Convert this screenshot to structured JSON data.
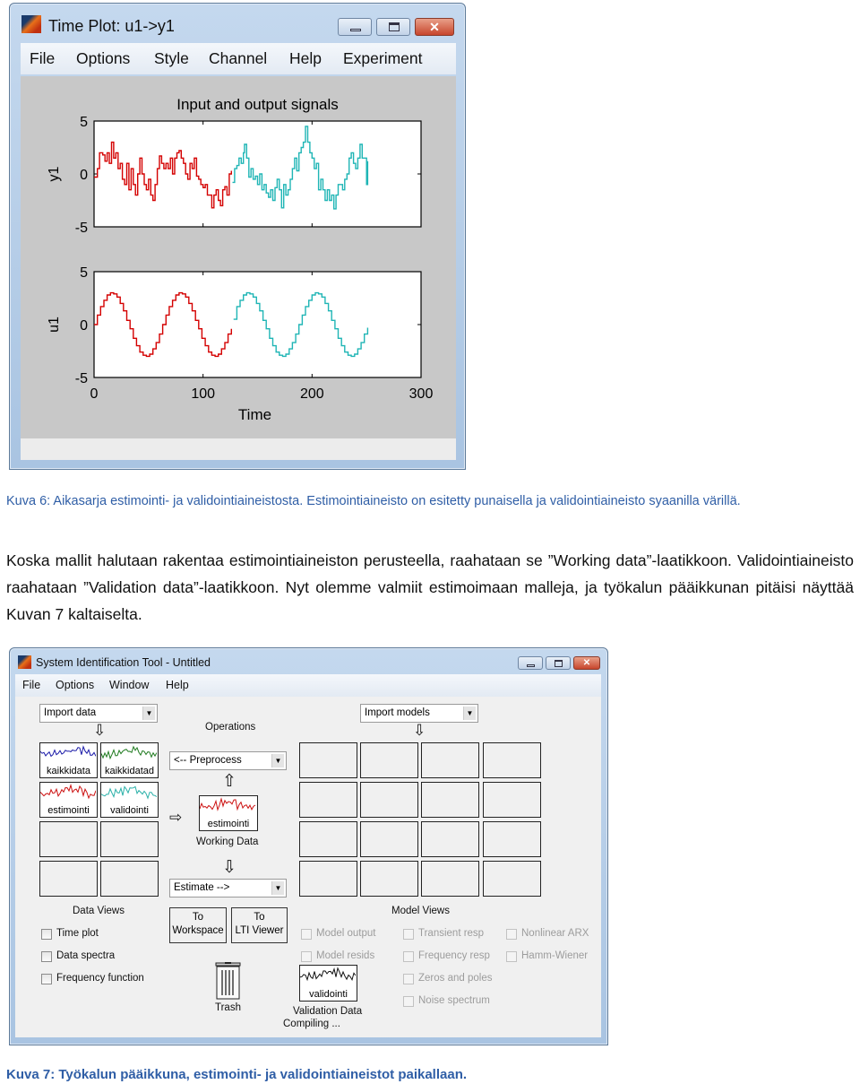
{
  "figure1": {
    "window_title": "Time Plot: u1->y1",
    "menu": [
      "File",
      "Options",
      "Style",
      "Channel",
      "Help",
      "Experiment"
    ],
    "window_buttons": {
      "minimize": "minimize-icon",
      "maximize": "maximize-icon",
      "close": "close-icon"
    }
  },
  "chart_data": [
    {
      "type": "line",
      "title": "Input and output signals",
      "xlabel": "",
      "ylabel": "y1",
      "xlim": [
        0,
        300
      ],
      "ylim": [
        -5,
        5
      ],
      "xticks": [
        "0",
        "100",
        "200",
        "300"
      ],
      "show_xtick_labels": false,
      "yticks": [
        "-5",
        "0",
        "5"
      ],
      "series": [
        {
          "color": "#d40000",
          "points": [
            [
              0,
              -0.3
            ],
            [
              3,
              0.5
            ],
            [
              5,
              2
            ],
            [
              8,
              1.8
            ],
            [
              10,
              1.2
            ],
            [
              12,
              2
            ],
            [
              14,
              1
            ],
            [
              16,
              3
            ],
            [
              18,
              1.5
            ],
            [
              20,
              2
            ],
            [
              22,
              0.5
            ],
            [
              24,
              1
            ],
            [
              26,
              -0.5
            ],
            [
              28,
              -1
            ],
            [
              30,
              1
            ],
            [
              32,
              -1.5
            ],
            [
              34,
              0.5
            ],
            [
              36,
              -1
            ],
            [
              38,
              -2
            ],
            [
              40,
              0
            ],
            [
              42,
              1.5
            ],
            [
              44,
              0
            ],
            [
              46,
              -1
            ],
            [
              48,
              -1.5
            ],
            [
              50,
              -0.5
            ],
            [
              52,
              -2
            ],
            [
              54,
              -2.5
            ],
            [
              56,
              -1
            ],
            [
              58,
              0.5
            ],
            [
              60,
              1.7
            ],
            [
              62,
              1
            ],
            [
              64,
              0.5
            ],
            [
              66,
              1
            ],
            [
              68,
              0.5
            ],
            [
              70,
              1.5
            ],
            [
              72,
              0
            ],
            [
              74,
              1.5
            ],
            [
              76,
              2
            ],
            [
              78,
              2.2
            ],
            [
              80,
              1.5
            ],
            [
              82,
              1
            ],
            [
              84,
              0
            ],
            [
              86,
              -0.5
            ],
            [
              88,
              1
            ],
            [
              90,
              0.5
            ],
            [
              92,
              1.5
            ],
            [
              94,
              -0.2
            ],
            [
              96,
              -0.5
            ],
            [
              98,
              -1
            ],
            [
              100,
              -1.3
            ],
            [
              102,
              -1
            ],
            [
              104,
              -2
            ],
            [
              106,
              -2
            ],
            [
              108,
              -3.2
            ],
            [
              110,
              -2
            ],
            [
              112,
              -1.5
            ],
            [
              114,
              -2.5
            ],
            [
              116,
              -3
            ],
            [
              118,
              -1.5
            ],
            [
              120,
              -1.2
            ],
            [
              122,
              -2
            ],
            [
              124,
              0
            ],
            [
              126,
              0.3
            ]
          ]
        },
        {
          "color": "#1fb5b5",
          "points": [
            [
              127,
              -0.8
            ],
            [
              129,
              0.5
            ],
            [
              131,
              0.8
            ],
            [
              133,
              1.5
            ],
            [
              135,
              1
            ],
            [
              137,
              2
            ],
            [
              138,
              2.8
            ],
            [
              140,
              1.5
            ],
            [
              142,
              -0.3
            ],
            [
              144,
              0.5
            ],
            [
              146,
              -0.5
            ],
            [
              148,
              -0.2
            ],
            [
              150,
              -1
            ],
            [
              152,
              0
            ],
            [
              154,
              -1.5
            ],
            [
              156,
              -1
            ],
            [
              158,
              -1.8
            ],
            [
              160,
              -2.2
            ],
            [
              162,
              -1.5
            ],
            [
              164,
              -2.5
            ],
            [
              166,
              -1.3
            ],
            [
              168,
              -0.5
            ],
            [
              170,
              -1.5
            ],
            [
              172,
              -3.2
            ],
            [
              174,
              -1
            ],
            [
              176,
              -2
            ],
            [
              178,
              -1.5
            ],
            [
              180,
              -0.5
            ],
            [
              182,
              0.5
            ],
            [
              184,
              1.5
            ],
            [
              186,
              0.3
            ],
            [
              188,
              2
            ],
            [
              190,
              2.5
            ],
            [
              192,
              3
            ],
            [
              194,
              4.5
            ],
            [
              196,
              3
            ],
            [
              198,
              2
            ],
            [
              200,
              1.5
            ],
            [
              202,
              0.5
            ],
            [
              204,
              1
            ],
            [
              206,
              -1.5
            ],
            [
              208,
              -0.5
            ],
            [
              210,
              -1.5
            ],
            [
              212,
              -2.5
            ],
            [
              214,
              -1.5
            ],
            [
              216,
              -2.5
            ],
            [
              218,
              -2
            ],
            [
              220,
              -3.3
            ],
            [
              222,
              -2
            ],
            [
              224,
              -1
            ],
            [
              226,
              -1
            ],
            [
              228,
              -1.5
            ],
            [
              230,
              -0.5
            ],
            [
              232,
              0
            ],
            [
              234,
              1.5
            ],
            [
              236,
              2
            ],
            [
              238,
              1
            ],
            [
              240,
              0.5
            ],
            [
              242,
              1.5
            ],
            [
              244,
              2.8
            ],
            [
              246,
              1.5
            ],
            [
              248,
              1.5
            ],
            [
              250,
              -1
            ],
            [
              251,
              1.2
            ]
          ]
        }
      ]
    },
    {
      "type": "line",
      "title": "",
      "xlabel": "Time",
      "ylabel": "u1",
      "xlim": [
        0,
        300
      ],
      "ylim": [
        -5,
        5
      ],
      "xticks": [
        "0",
        "100",
        "200",
        "300"
      ],
      "show_xtick_labels": true,
      "yticks": [
        "-5",
        "0",
        "5"
      ],
      "series": [
        {
          "color": "#d40000",
          "x_start": 0,
          "x_step": 3,
          "values": [
            0,
            0.9,
            1.7,
            2.3,
            2.8,
            3.0,
            2.9,
            2.6,
            2.0,
            1.3,
            0.4,
            -0.4,
            -1.3,
            -2.0,
            -2.6,
            -2.9,
            -3.0,
            -2.8,
            -2.3,
            -1.7,
            -0.9,
            0,
            0.9,
            1.7,
            2.3,
            2.8,
            3.0,
            2.9,
            2.6,
            2.0,
            1.3,
            0.4,
            -0.4,
            -1.3,
            -2.0,
            -2.6,
            -2.9,
            -3.0,
            -2.8,
            -2.3,
            -1.7,
            -0.9,
            -0.4
          ]
        },
        {
          "color": "#1fb5b5",
          "x_start": 128,
          "x_step": 3,
          "values": [
            0.5,
            1.7,
            2.3,
            2.8,
            3.0,
            2.9,
            2.6,
            2.0,
            1.3,
            0.4,
            -0.4,
            -1.3,
            -2.0,
            -2.6,
            -2.9,
            -3.0,
            -2.8,
            -2.3,
            -1.7,
            -0.9,
            0,
            0.9,
            1.7,
            2.3,
            2.8,
            3.0,
            2.9,
            2.6,
            2.0,
            1.3,
            0.4,
            -0.4,
            -1.3,
            -2.0,
            -2.6,
            -2.9,
            -3.0,
            -2.8,
            -2.3,
            -1.7,
            -0.9,
            -0.3
          ]
        }
      ]
    }
  ],
  "caption1": "Kuva 6: Aikasarja estimointi- ja validointiaineistosta. Estimointiaineisto on esitetty punaisella ja validointiaineisto syaanilla värillä.",
  "paragraph": "Koska mallit halutaan rakentaa estimointiaineiston perusteella, raahataan se ”Working data”-laatikkoon. Validointiaineisto raahataan ”Validation data”-laatikkoon. Nyt olemme valmiit estimoimaan malleja, ja työkalun pääikkunan pitäisi näyttää Kuvan 7 kaltaiselta.",
  "sitool": {
    "window_title": "System Identification Tool - Untitled",
    "menu": [
      "File",
      "Options",
      "Window",
      "Help"
    ],
    "import_data": "Import data",
    "import_models": "Import models",
    "operations": "Operations",
    "preprocess": "<-- Preprocess",
    "estimate": "Estimate -->",
    "working_data_label": "Working Data",
    "working_data_item": "estimointi",
    "data_items": [
      {
        "name": "kaikkidata",
        "color": "#1a1aa8"
      },
      {
        "name": "kaikkidatad",
        "color": "#1f7a1f"
      },
      {
        "name": "estimointi",
        "color": "#cc1111"
      },
      {
        "name": "validointi",
        "color": "#2ab0a8"
      }
    ],
    "data_views_label": "Data Views",
    "data_views": [
      "Time plot",
      "Data spectra",
      "Frequency function"
    ],
    "to_workspace": [
      "To",
      "Workspace"
    ],
    "to_lti": [
      "To",
      "LTI Viewer"
    ],
    "trash": "Trash",
    "model_views_label": "Model Views",
    "model_views_col1": [
      "Model output",
      "Model resids"
    ],
    "model_views_col2": [
      "Transient resp",
      "Frequency resp",
      "Zeros and poles",
      "Noise spectrum"
    ],
    "model_views_col3": [
      "Nonlinear ARX",
      "Hamm-Wiener"
    ],
    "validation_item": "validointi",
    "validation_label": "Validation Data",
    "status": "Compiling ..."
  },
  "caption2": "Kuva 7: Työkalun pääikkuna, estimointi- ja validointiaineistot paikallaan."
}
